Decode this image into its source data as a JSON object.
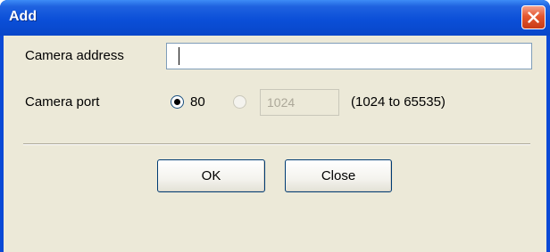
{
  "window": {
    "title": "Add"
  },
  "form": {
    "camera_address_label": "Camera address",
    "camera_address_value": "",
    "camera_port_label": "Camera port",
    "port_option_default": "80",
    "port_option_custom_value": "1024",
    "port_range_hint": "(1024 to 65535)",
    "selected_port_option": "80"
  },
  "buttons": {
    "ok_label": "OK",
    "close_label": "Close"
  }
}
